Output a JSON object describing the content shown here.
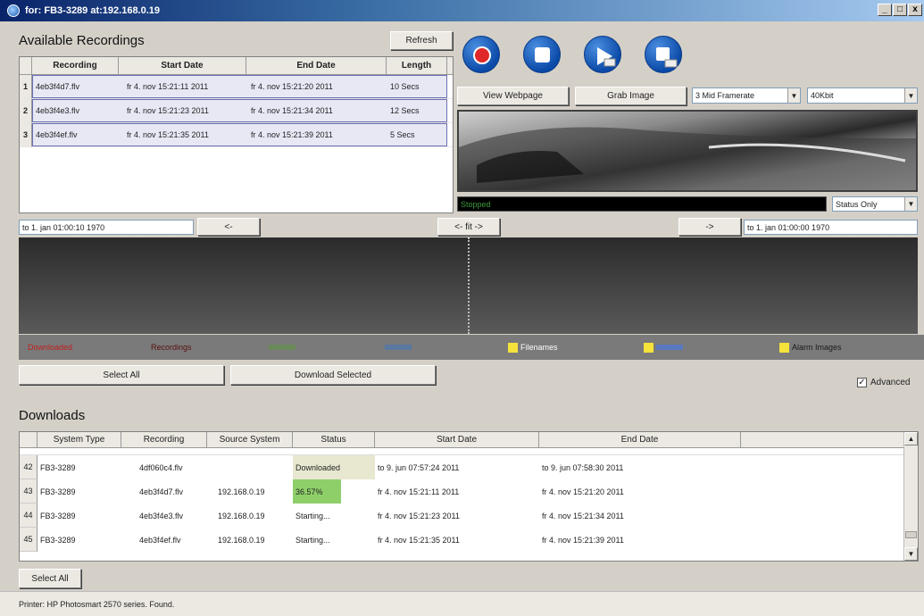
{
  "window": {
    "title": "for: FB3-3289  at:192.168.0.19",
    "min": "_",
    "max": "□",
    "close": "x"
  },
  "recordings": {
    "heading": "Available Recordings",
    "refresh_label": "Refresh",
    "columns": [
      "Recording",
      "Start Date",
      "End Date",
      "Length"
    ],
    "rows": [
      {
        "num": "1",
        "recording": "4eb3f4d7.flv",
        "start": "fr 4. nov 15:21:11 2011",
        "end": "fr 4. nov 15:21:20 2011",
        "length": "10 Secs"
      },
      {
        "num": "2",
        "recording": "4eb3f4e3.flv",
        "start": "fr 4. nov 15:21:23 2011",
        "end": "fr 4. nov 15:21:34 2011",
        "length": "12 Secs"
      },
      {
        "num": "3",
        "recording": "4eb3f4ef.flv",
        "start": "fr 4. nov 15:21:35 2011",
        "end": "fr 4. nov 15:21:39 2011",
        "length": "5 Secs"
      }
    ]
  },
  "controls": {
    "view_webpage": "View Webpage",
    "grab_image": "Grab Image",
    "framerate": "3 Mid Framerate",
    "bitrate": "40Kbit",
    "status_text": "Stopped",
    "status_mode": "Status Only"
  },
  "timeline": {
    "left_time": "to 1. jan 01:00:10 1970",
    "left_btn": "<-",
    "fit_btn": "<- fit ->",
    "right_btn": "->",
    "right_time": "to 1. jan 01:00:00 1970"
  },
  "legend": [
    {
      "label": "Downloaded",
      "color": "#c0201c"
    },
    {
      "label": "Recordings",
      "color": "#5a1010"
    },
    {
      "label": "Filenames",
      "color": "#ffffff"
    },
    {
      "label": "Alarm Images",
      "color": "#1a1a1a"
    }
  ],
  "actions": {
    "select_all": "Select All",
    "download_selected": "Download Selected",
    "advanced_label": "Advanced",
    "advanced_checked": "✓"
  },
  "downloads": {
    "heading": "Downloads",
    "columns": [
      "System Type",
      "Recording",
      "Source System",
      "Status",
      "Start Date",
      "End Date"
    ],
    "rows": [
      {
        "num": "42",
        "system": "FB3-3289",
        "recording": "4df060c4.flv",
        "source": "",
        "status": "Downloaded",
        "start": "to 9. jun 07:57:24 2011",
        "end": "to 9. jun 07:58:30 2011"
      },
      {
        "num": "43",
        "system": "FB3-3289",
        "recording": "4eb3f4d7.flv",
        "source": "192.168.0.19",
        "status": "36.57%",
        "start": "fr 4. nov 15:21:11 2011",
        "end": "fr 4. nov 15:21:20 2011"
      },
      {
        "num": "44",
        "system": "FB3-3289",
        "recording": "4eb3f4e3.flv",
        "source": "192.168.0.19",
        "status": "Starting...",
        "start": "fr 4. nov 15:21:23 2011",
        "end": "fr 4. nov 15:21:34 2011"
      },
      {
        "num": "45",
        "system": "FB3-3289",
        "recording": "4eb3f4ef.flv",
        "source": "192.168.0.19",
        "status": "Starting...",
        "start": "fr 4. nov 15:21:35 2011",
        "end": "fr 4. nov 15:21:39 2011"
      }
    ],
    "progress_pct": 0.3657,
    "select_all": "Select All"
  },
  "footer": {
    "status": "Printer: HP Photosmart 2570 series. Found."
  }
}
